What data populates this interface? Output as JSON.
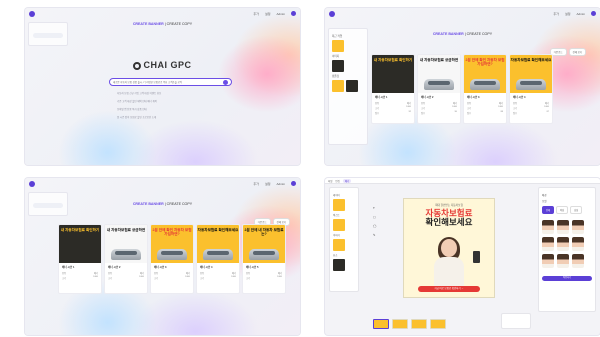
{
  "nav": {
    "tab_banner": "CREATE BANNER",
    "separator": "|",
    "tab_copy": "CREATE COPY",
    "top_items": [
      "추가",
      "설정",
      "Admin"
    ]
  },
  "home": {
    "brand": "CHAI GPC",
    "prompt_text": "새로운 자동차 보험 상품 출시, 더 저렴한 보험료로 주요 고객층을 공략",
    "hints": [
      "자동차 보험 신규 가입 고객 대상 이벤트 홍보",
      "기존 고객 대상 할인 혜택 안내 배너 제작",
      "모바일 앱 전용 특가 상품 안내",
      "봄 시즌 맞이 보험료 할인 프로모션 소개"
    ]
  },
  "results": {
    "buttons": [
      "다운로드",
      "전체 보기"
    ],
    "cards": [
      {
        "headline": "내 자동차보험료 확인하기",
        "style": "dark",
        "title": "배너 시안 1",
        "rows": [
          [
            "유형",
            "배너"
          ],
          [
            "크기",
            "1080"
          ],
          [
            "점수",
            "92"
          ]
        ]
      },
      {
        "headline": "내 자동차보험료 궁금하면",
        "style": "white",
        "title": "배너 시안 2",
        "rows": [
          [
            "유형",
            "배너"
          ],
          [
            "크기",
            "1080"
          ],
          [
            "점수",
            "90"
          ]
        ]
      },
      {
        "headline": "2분 만에 확인 자동차 보험 가입하면?",
        "style": "yellow",
        "title": "배너 시안 3",
        "rows": [
          [
            "유형",
            "배너"
          ],
          [
            "크기",
            "1080"
          ],
          [
            "점수",
            "88"
          ]
        ]
      },
      {
        "headline": "자동차보험료 확인해보세요",
        "style": "yellow",
        "title": "배너 시안 4",
        "rows": [
          [
            "유형",
            "배너"
          ],
          [
            "크기",
            "1080"
          ],
          [
            "점수",
            "87"
          ]
        ]
      },
      {
        "headline": "2분 만에 내 자동차 보험료는?",
        "style": "yellow",
        "title": "배너 시안 5",
        "rows": [
          [
            "유형",
            "배너"
          ],
          [
            "크기",
            "1080"
          ],
          [
            "점수",
            "85"
          ]
        ]
      }
    ],
    "sidebar_labels": [
      "최근 작업",
      "이미지",
      "템플릿"
    ]
  },
  "editor": {
    "top_tabs": [
      "파일",
      "편집",
      "배너"
    ],
    "left_labels": [
      "레이어",
      "텍스트",
      "이미지",
      "요소"
    ],
    "tools": [
      "T",
      "▢",
      "◯",
      "✎"
    ],
    "canvas_sub": "최대 할인받는 자동차보험",
    "canvas_h1": "자동차보험료",
    "canvas_h2": "확인해보세요",
    "canvas_cta": "지금 바로 보험료 확인하기 →",
    "right_labels": [
      "배경",
      "모델"
    ],
    "segs": [
      "전체",
      "여성",
      "남성"
    ],
    "apply": "적용하기"
  },
  "colors": {
    "accent": "#5b3fd6",
    "yellow": "#fbc02d",
    "red": "#e53935"
  }
}
